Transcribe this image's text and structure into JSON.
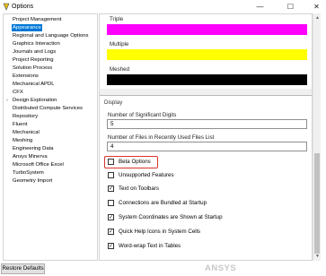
{
  "window": {
    "title": "Options",
    "controls": {
      "minimize": "—",
      "maximize": "☐",
      "close": "✕"
    }
  },
  "nav_tree": {
    "items": [
      {
        "label": "Project Management"
      },
      {
        "label": "Appearance",
        "selected": true
      },
      {
        "label": "Regional and Language Options"
      },
      {
        "label": "Graphics Interaction"
      },
      {
        "label": "Journals and Logs"
      },
      {
        "label": "Project Reporting"
      },
      {
        "label": "Solution Process"
      },
      {
        "label": "Extensions"
      },
      {
        "label": "Mechanical APDL"
      },
      {
        "label": "CFX"
      },
      {
        "label": "Design Exploration",
        "expandable": true
      },
      {
        "label": "Distributed Compute Services"
      },
      {
        "label": "Repository"
      },
      {
        "label": "Fluent"
      },
      {
        "label": "Mechanical"
      },
      {
        "label": "Meshing"
      },
      {
        "label": "Engineering Data"
      },
      {
        "label": "Ansys Minerva"
      },
      {
        "label": "Microsoft Office Excel"
      },
      {
        "label": "TurboSystem"
      },
      {
        "label": "Geometry Import"
      }
    ],
    "expander_glyph": "›"
  },
  "colors": {
    "triple_label": "Triple",
    "triple_color": "#ff00ff",
    "multiple_label": "Multiple",
    "multiple_color": "#ffff00",
    "meshed_label": "Meshed",
    "meshed_color": "#000000"
  },
  "display": {
    "header": "Display",
    "sig_digits_label": "Number of Significant Digits",
    "sig_digits_value": "5",
    "recent_files_label": "Number of Files in Recently Used Files List",
    "recent_files_value": "4",
    "checkboxes": [
      {
        "label": "Beta Options",
        "checked": false
      },
      {
        "label": "Unsupported Features",
        "checked": false
      },
      {
        "label": "Text on Toolbars",
        "checked": true
      },
      {
        "label": "Connections are Bundled at Startup",
        "checked": false
      },
      {
        "label": "System Coordinates are Shown at Startup",
        "checked": true
      },
      {
        "label": "Quick Help Icons in System Cells",
        "checked": true
      },
      {
        "label": "Word-wrap Text in Tables",
        "checked": true
      }
    ],
    "check_glyph": "✓"
  },
  "footer": {
    "restore_defaults": "Restore Defaults",
    "watermark": "ANSYS"
  }
}
